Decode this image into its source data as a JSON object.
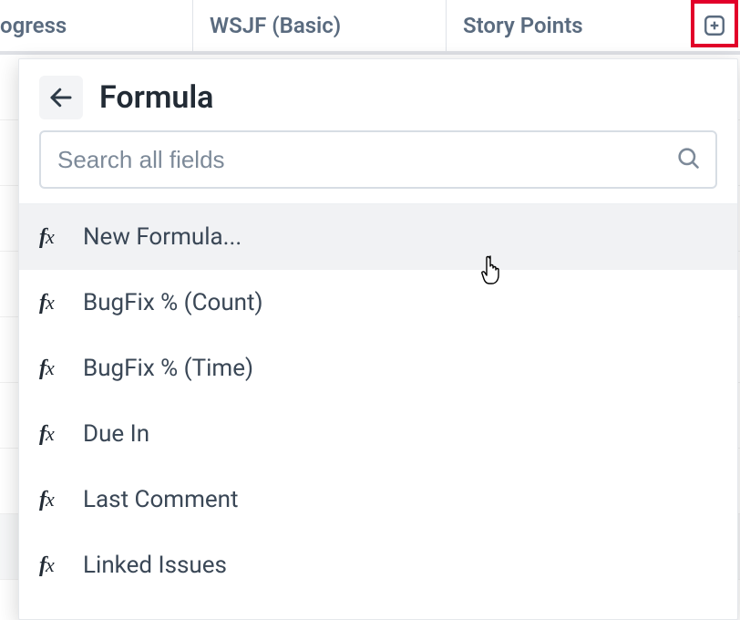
{
  "columns": {
    "col1": "ogress",
    "col2": "WSJF (Basic)",
    "col3": "Story Points"
  },
  "popup": {
    "title": "Formula",
    "search_placeholder": "Search all fields",
    "items": [
      {
        "label": "New Formula...",
        "hovered": true
      },
      {
        "label": "BugFix % (Count)",
        "hovered": false
      },
      {
        "label": "BugFix % (Time)",
        "hovered": false
      },
      {
        "label": "Due In",
        "hovered": false
      },
      {
        "label": "Last Comment",
        "hovered": false
      },
      {
        "label": "Linked Issues",
        "hovered": false
      }
    ]
  }
}
